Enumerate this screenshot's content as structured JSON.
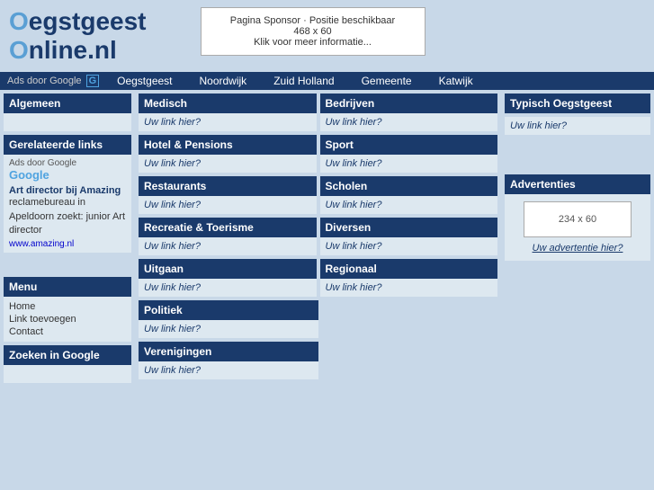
{
  "site": {
    "title_part1": "egstgeest",
    "title_part2": "nline.nl",
    "title_o1": "O",
    "title_o2": "O"
  },
  "sponsor": {
    "line1": "Pagina Sponsor · Positie beschikbaar",
    "line2": "468 x 60",
    "line3": "Klik voor meer informatie..."
  },
  "navbar": {
    "ads_label": "Ads door Google",
    "links": [
      {
        "label": "Oegstgeest",
        "href": "#"
      },
      {
        "label": "Noordwijk",
        "href": "#"
      },
      {
        "label": "Zuid Holland",
        "href": "#"
      },
      {
        "label": "Gemeente",
        "href": "#"
      },
      {
        "label": "Katwijk",
        "href": "#"
      }
    ]
  },
  "sidebar": {
    "algemeen_title": "Algemeen",
    "gerelateerde_title": "Gerelateerde links",
    "ads_label": "Ads door Google",
    "google_logo": "Google",
    "ad_link_text": "Art director bij Amazing",
    "ad_text1": "reclamebureau in Apeldoorn zoekt: junior Art director",
    "ad_small_link": "www.amazing.nl",
    "menu_title": "Menu",
    "menu_items": [
      {
        "label": "Home"
      },
      {
        "label": "Link toevoegen"
      },
      {
        "label": "Contact"
      }
    ],
    "zoeken_title": "Zoeken in Google"
  },
  "categories": {
    "row1": [
      {
        "title": "Medisch",
        "link": "Uw link hier?"
      },
      {
        "title": "Bedrijven",
        "link": "Uw link hier?"
      }
    ],
    "row2": [
      {
        "title": "Hotel & Pensions",
        "link": "Uw link hier?"
      },
      {
        "title": "Sport",
        "link": "Uw link hier?"
      }
    ],
    "row3": [
      {
        "title": "Restaurants",
        "link": "Uw link hier?"
      },
      {
        "title": "Scholen",
        "link": "Uw link hier?"
      }
    ],
    "row4": [
      {
        "title": "Recreatie & Toerisme",
        "link": "Uw link hier?"
      },
      {
        "title": "Diversen",
        "link": "Uw link hier?"
      }
    ],
    "row5": [
      {
        "title": "Uitgaan",
        "link": "Uw link hier?"
      },
      {
        "title": "Regionaal",
        "link": "Uw link hier?"
      }
    ],
    "row6": [
      {
        "title": "Politiek",
        "link": "Uw link hier?"
      }
    ],
    "row7": [
      {
        "title": "Verenigingen",
        "link": "Uw link hier?"
      }
    ]
  },
  "right_panel": {
    "typisch_title": "Typisch Oegstgeest",
    "typisch_link": "Uw link hier?",
    "advertenties_title": "Advertenties",
    "ad_size": "234 x 60",
    "ad_link": "Uw advertentie hier?"
  }
}
